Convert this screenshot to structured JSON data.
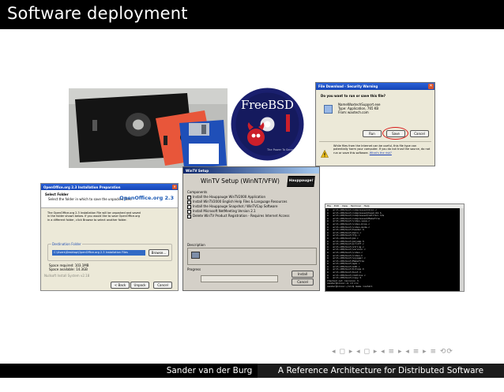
{
  "slide": {
    "title": "Software deployment"
  },
  "freebsd": {
    "logo_text": "FreeBSD",
    "tagline": "The Power To Serve"
  },
  "ie_dialog": {
    "window_title": "File Download - Security Warning",
    "question": "Do you want to run or save this file?",
    "name_label": "Name:",
    "name_value": "WaxtechSupport.exe",
    "type_label": "Type:",
    "type_value": "Application, 765 KB",
    "from_label": "From:",
    "from_value": "waxtech.com",
    "run_label": "Run",
    "save_label": "Save",
    "cancel_label": "Cancel",
    "warning_text": "While files from the Internet can be useful, this file type can potentially harm your computer. If you do not trust the source, do not run or save this software.",
    "risk_link": "What's the risk?"
  },
  "openoffice": {
    "window_title": "OpenOffice.org 2.3 Installation Preparation",
    "header_title": "Select Folder",
    "header_subtitle": "Select the folder in which to save the unpacked files.",
    "brand": "OpenOffice.org 2.3",
    "body_text": "The OpenOffice.org 2.3 Installation File will be unpacked and saved in the folder shown below. If you would like to save OpenOffice.org in a different folder, click Browse to select another folder.",
    "folder_group_label": "Destination Folder",
    "folder_path": "C:\\Users\\Desktop\\OpenOffice.org 2.3 Installation Files",
    "browse_label": "Browse...",
    "space_required": "Space required: 103.1MB",
    "space_available": "Space available: 14.3GB",
    "footer_text": "Nullsoft Install System v2.18",
    "back_label": "< Back",
    "unpack_label": "Unpack",
    "cancel_label": "Cancel"
  },
  "wintv": {
    "window_title": "WinTV Setup",
    "heading": "WinTV Setup (WinNT/VFW)",
    "brand": "Hauppauge!",
    "components_label": "Components",
    "components": [
      "Install the Hauppauge WinTV2000 Application",
      "Install WinTV2000 English Help Files & Language Resources",
      "Install the Hauppauge Snapshot / WinTVCap Software",
      "Install Microsoft NetMeeting Version 2.1",
      "Delete WinTV Product Registration - Requires Internet Access"
    ],
    "description_label": "Description",
    "progress_label": "Progress",
    "install_label": "Install",
    "cancel_label": "Cancel"
  },
  "terminal": {
    "menu_items": [
      "File",
      "Edit",
      "View",
      "Terminal",
      "Help"
    ],
    "lines": [
      "A   arch-x86/boot/compressed/misc.c",
      "A   arch-x86/boot/compressed/head_64.S",
      "A   arch-x86/boot/compressed/vmlinux.lds",
      "A   arch-x86/boot/compressed/Makefile",
      "A   arch-x86/boot/video-vesa.c",
      "A   arch-x86/boot/video-bios.c",
      "A   arch-x86/boot/video-mode.c",
      "A   arch-x86/boot/header.S",
      "A   arch-x86/boot/main.c",
      "A   arch-x86/boot/tty.c",
      "A   arch-x86/boot/pm.c",
      "A   arch-x86/boot/pmjump.S",
      "A   arch-x86/boot/printf.c",
      "A   arch-x86/boot/string.c",
      "A   arch-x86/boot/version.c",
      "A   arch-x86/boot/video.c",
      "A   arch-x86/boot/video.h",
      "A   arch-x86/boot/voyager.c",
      "A   arch-x86/boot/Makefile",
      "A   arch-x86/boot/apm.c",
      "A   arch-x86/boot/a20.c",
      "A   arch-x86/boot/bitops.h",
      "A   arch-x86/boot/boot.h",
      "A   arch-x86/boot/cmdline.c",
      "A   arch-x86/boot/copy.S",
      "Checked out revision 3.",
      "sander@nixos:~$ cd nix",
      "sander@nixos:~/nix$ make install"
    ]
  },
  "nav": {
    "symbols": "◂ ◻ ▸  ◂ ◻ ▸  ◂ ≡ ▸  ◂ ≡ ▸   ≡   ⟲⟳"
  },
  "footer": {
    "author": "Sander van der Burg",
    "talk_title": "A Reference Architecture for Distributed Software Deployment"
  },
  "colors": {
    "title_bar": "#000000",
    "footer_dark": "#000000",
    "footer_light": "#1c1c1c",
    "freebsd_red": "#cc1f2a",
    "freebsd_blue": "#1a1f6e"
  }
}
